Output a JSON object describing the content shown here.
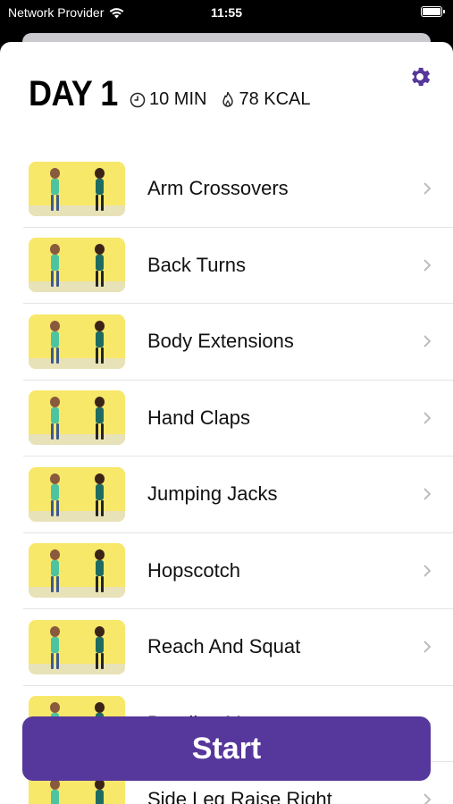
{
  "status_bar": {
    "carrier": "Network Provider",
    "time": "11:55"
  },
  "header": {
    "title": "DAY 1",
    "duration": "10 MIN",
    "calories": "78 KCAL"
  },
  "exercises": [
    {
      "label": "Arm Crossovers"
    },
    {
      "label": "Back Turns"
    },
    {
      "label": "Body Extensions"
    },
    {
      "label": "Hand Claps"
    },
    {
      "label": "Jumping Jacks"
    },
    {
      "label": "Hopscotch"
    },
    {
      "label": "Reach And Squat"
    },
    {
      "label": "Bending Move"
    },
    {
      "label": "Side Leg Raise Right"
    }
  ],
  "start_button": {
    "label": "Start"
  },
  "colors": {
    "accent": "#56379b",
    "thumbnail_bg": "#f7e86a"
  }
}
